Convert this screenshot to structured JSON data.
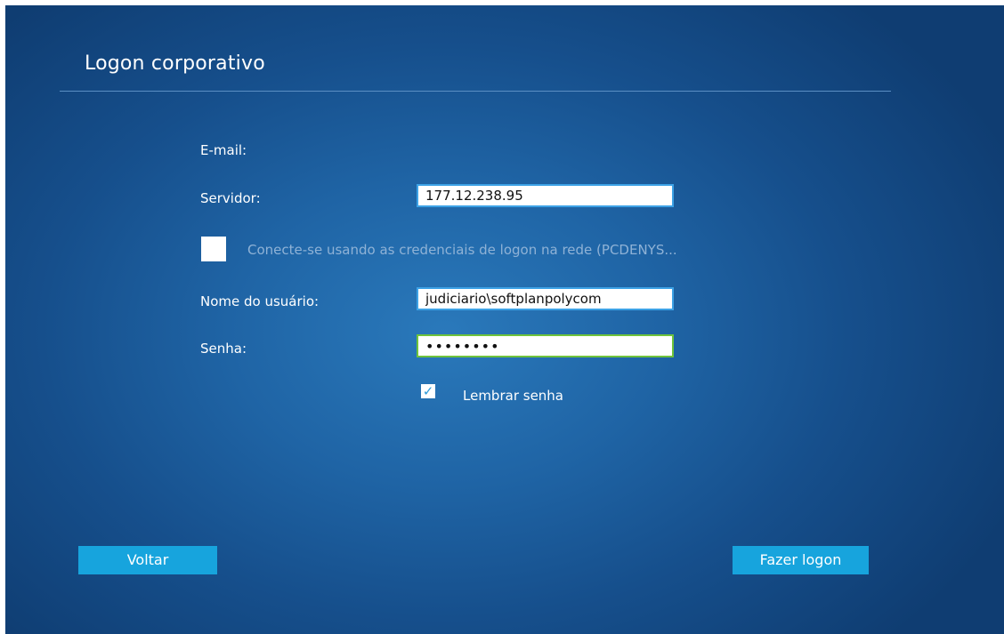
{
  "window": {
    "title": "Logon corporativo"
  },
  "form": {
    "email_label": "E-mail:",
    "server_label": "Servidor:",
    "server_value": "177.12.238.95",
    "network_credentials_label": "Conecte-se usando as credenciais de logon na rede (PCDENYS...",
    "network_credentials_checked": false,
    "username_label": "Nome do usuário:",
    "username_value": "judiciario\\softplanpolycom",
    "password_label": "Senha:",
    "password_value": "••••••••",
    "remember_label": "Lembrar senha",
    "remember_checked": true,
    "remember_check_glyph": "✓"
  },
  "buttons": {
    "back_label": "Voltar",
    "logon_label": "Fazer logon"
  },
  "colors": {
    "background": "#1f64a5",
    "accent_button": "#17a4dd",
    "field_border": "#3da2e6",
    "focused_border": "#6fc33b",
    "disabled_text": "#8fb2d6"
  }
}
